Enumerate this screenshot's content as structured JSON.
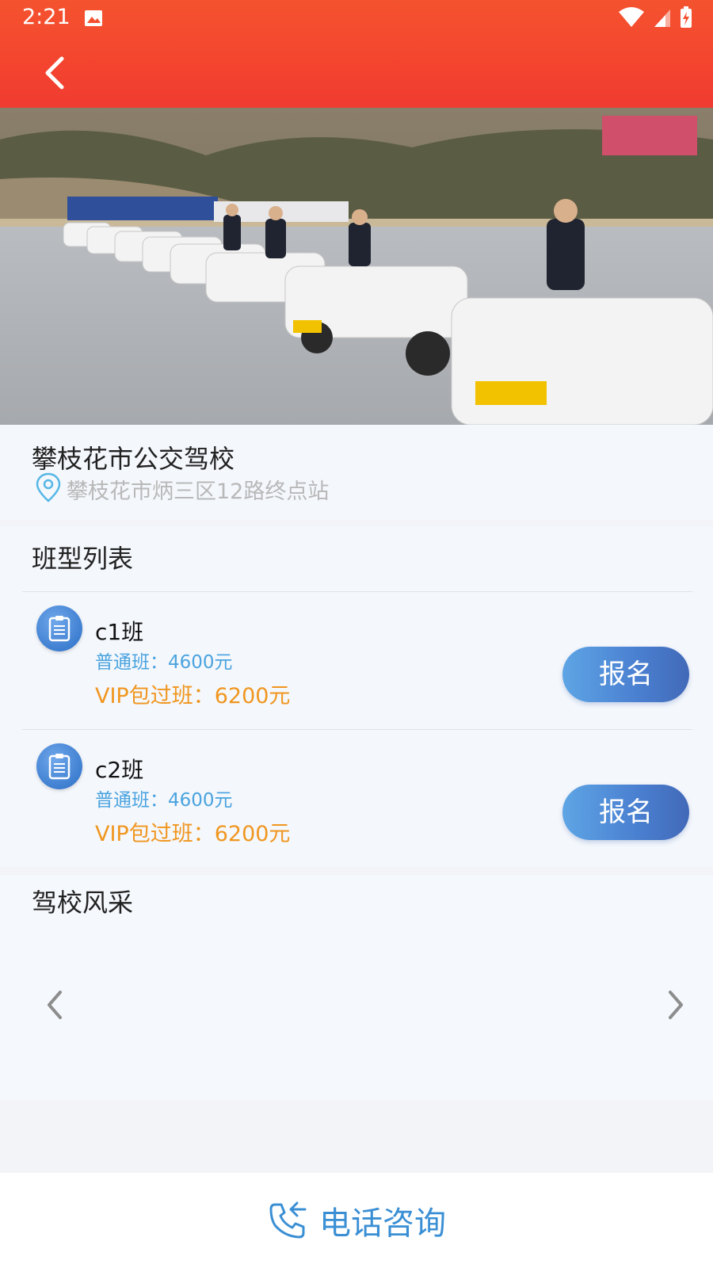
{
  "status_bar": {
    "time": "2:21"
  },
  "school": {
    "name": "攀枝花市公交驾校",
    "address": "攀枝花市炳三区12路终点站"
  },
  "class_list": {
    "title": "班型列表",
    "items": [
      {
        "name": "c1班",
        "normal": "普通班：4600元",
        "vip": "VIP包过班：6200元",
        "button": "报名"
      },
      {
        "name": "c2班",
        "normal": "普通班：4600元",
        "vip": "VIP包过班：6200元",
        "button": "报名"
      }
    ]
  },
  "gallery": {
    "title": "驾校风采"
  },
  "bottom": {
    "consult_label": "电话咨询"
  },
  "colors": {
    "header": "#f4442f",
    "accent_blue": "#4a7fd0",
    "price_normal": "#4aa3df",
    "price_vip": "#f0961f"
  },
  "icons": [
    "image-icon",
    "wifi-icon",
    "signal-icon",
    "battery-icon",
    "back-arrow-icon",
    "location-icon",
    "clipboard-icon",
    "chevron-left-icon",
    "chevron-right-icon",
    "phone-icon"
  ]
}
